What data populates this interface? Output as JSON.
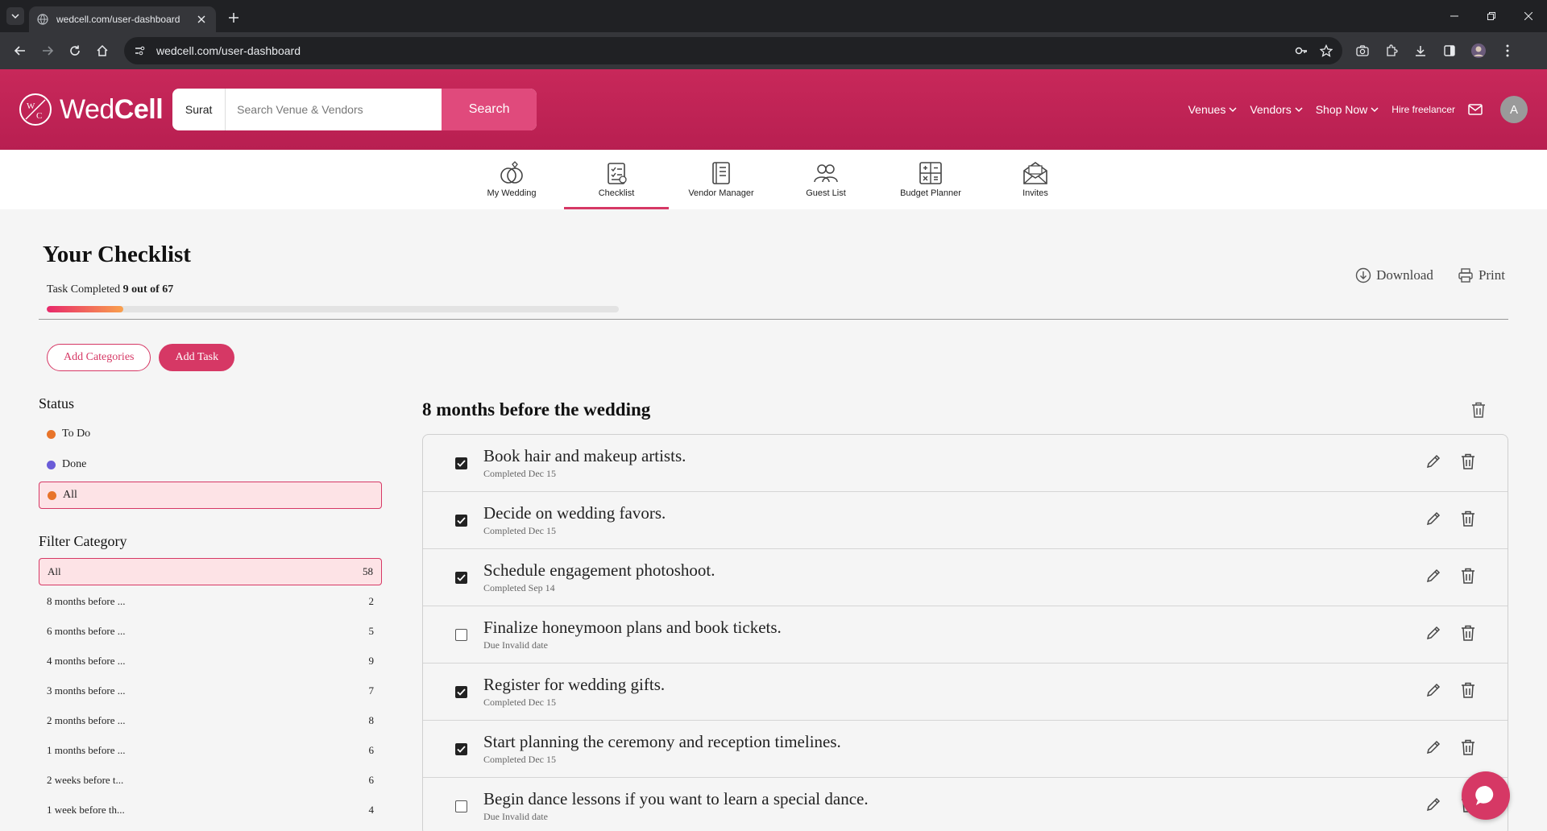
{
  "browser": {
    "tab_title": "wedcell.com/user-dashboard",
    "url": "wedcell.com/user-dashboard"
  },
  "site": {
    "logo_text_light": "Wed",
    "logo_text_bold": "Cell",
    "city": "Surat",
    "search_placeholder": "Search Venue & Vendors",
    "search_button": "Search",
    "nav": {
      "venues": "Venues",
      "vendors": "Vendors",
      "shop_now": "Shop Now",
      "hire_freelancer": "Hire freelancer",
      "avatar_initial": "A"
    },
    "accent_color": "#d63865"
  },
  "section_tabs": [
    {
      "label": "My Wedding",
      "icon": "rings-icon"
    },
    {
      "label": "Checklist",
      "icon": "checklist-icon",
      "active": true
    },
    {
      "label": "Vendor Manager",
      "icon": "notebook-icon"
    },
    {
      "label": "Guest List",
      "icon": "guests-icon"
    },
    {
      "label": "Budget Planner",
      "icon": "calculator-icon"
    },
    {
      "label": "Invites",
      "icon": "envelope-icon"
    }
  ],
  "checklist": {
    "title": "Your Checklist",
    "progress_label": "Task Completed",
    "progress_value": "9 out of 67",
    "progress_fraction": 0.134,
    "download_label": "Download",
    "print_label": "Print",
    "add_categories": "Add Categories",
    "add_task": "Add Task"
  },
  "status": {
    "heading": "Status",
    "items": [
      {
        "label": "To Do",
        "color": "#e8742a"
      },
      {
        "label": "Done",
        "color": "#6a5cd8"
      },
      {
        "label": "All",
        "color": "#e8742a",
        "selected": true
      }
    ]
  },
  "filter": {
    "heading": "Filter Category",
    "items": [
      {
        "label": "All",
        "count": "58",
        "selected": true
      },
      {
        "label": "8 months before ...",
        "count": "2"
      },
      {
        "label": "6 months before ...",
        "count": "5"
      },
      {
        "label": "4 months before ...",
        "count": "9"
      },
      {
        "label": "3 months before ...",
        "count": "7"
      },
      {
        "label": "2 months before ...",
        "count": "8"
      },
      {
        "label": "1 months before ...",
        "count": "6"
      },
      {
        "label": "2 weeks before t...",
        "count": "6"
      },
      {
        "label": "1 week before th...",
        "count": "4"
      }
    ]
  },
  "task_group": {
    "title": "8 months before the wedding",
    "tasks": [
      {
        "name": "Book hair and makeup artists.",
        "sub": "Completed Dec 15",
        "done": true
      },
      {
        "name": "Decide on wedding favors.",
        "sub": "Completed Dec 15",
        "done": true
      },
      {
        "name": "Schedule engagement photoshoot.",
        "sub": "Completed Sep 14",
        "done": true
      },
      {
        "name": "Finalize honeymoon plans and book tickets.",
        "sub": "Due Invalid date",
        "done": false
      },
      {
        "name": "Register for wedding gifts.",
        "sub": "Completed Dec 15",
        "done": true
      },
      {
        "name": "Start planning the ceremony and reception timelines.",
        "sub": "Completed Dec 15",
        "done": true
      },
      {
        "name": "Begin dance lessons if you want to learn a special dance.",
        "sub": "Due Invalid date",
        "done": false
      }
    ]
  }
}
